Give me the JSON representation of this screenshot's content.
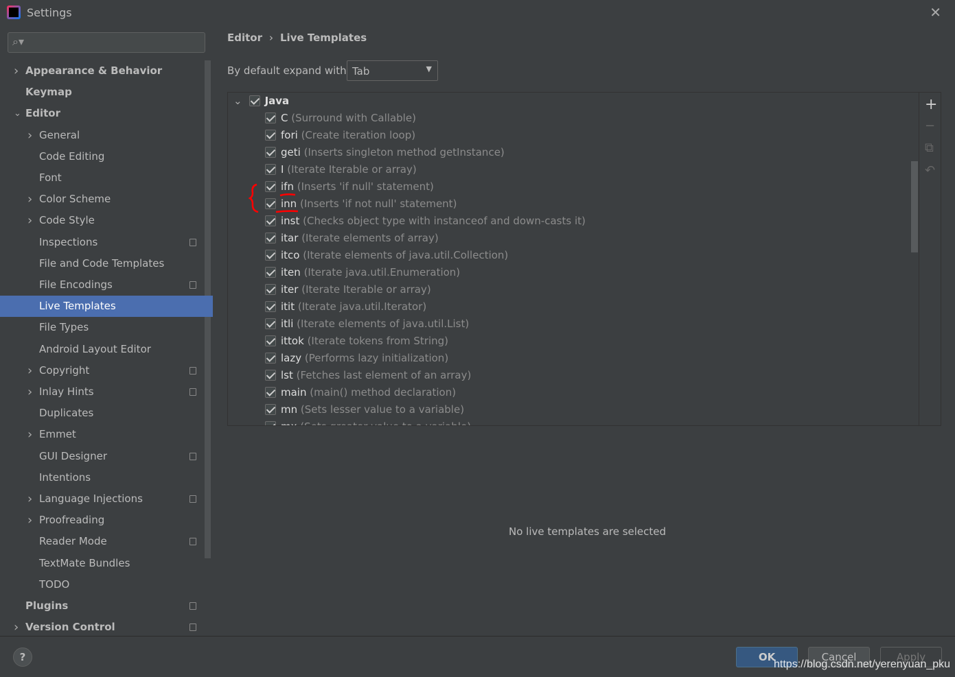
{
  "window": {
    "title": "Settings"
  },
  "search": {
    "placeholder": ""
  },
  "sidebar": {
    "items": [
      {
        "label": "Appearance & Behavior",
        "level": 0,
        "arrow": "right",
        "bold": true
      },
      {
        "label": "Keymap",
        "level": 0,
        "bold": true
      },
      {
        "label": "Editor",
        "level": 0,
        "arrow": "down",
        "bold": true
      },
      {
        "label": "General",
        "level": 1,
        "arrow": "right"
      },
      {
        "label": "Code Editing",
        "level": 1
      },
      {
        "label": "Font",
        "level": 1
      },
      {
        "label": "Color Scheme",
        "level": 1,
        "arrow": "right"
      },
      {
        "label": "Code Style",
        "level": 1,
        "arrow": "right"
      },
      {
        "label": "Inspections",
        "level": 1,
        "project": true
      },
      {
        "label": "File and Code Templates",
        "level": 1
      },
      {
        "label": "File Encodings",
        "level": 1,
        "project": true
      },
      {
        "label": "Live Templates",
        "level": 1,
        "selected": true
      },
      {
        "label": "File Types",
        "level": 1
      },
      {
        "label": "Android Layout Editor",
        "level": 1
      },
      {
        "label": "Copyright",
        "level": 1,
        "arrow": "right",
        "project": true
      },
      {
        "label": "Inlay Hints",
        "level": 1,
        "arrow": "right",
        "project": true
      },
      {
        "label": "Duplicates",
        "level": 1
      },
      {
        "label": "Emmet",
        "level": 1,
        "arrow": "right"
      },
      {
        "label": "GUI Designer",
        "level": 1,
        "project": true
      },
      {
        "label": "Intentions",
        "level": 1
      },
      {
        "label": "Language Injections",
        "level": 1,
        "arrow": "right",
        "project": true
      },
      {
        "label": "Proofreading",
        "level": 1,
        "arrow": "right"
      },
      {
        "label": "Reader Mode",
        "level": 1,
        "project": true
      },
      {
        "label": "TextMate Bundles",
        "level": 1
      },
      {
        "label": "TODO",
        "level": 1
      },
      {
        "label": "Plugins",
        "level": 0,
        "bold": true,
        "project": true
      },
      {
        "label": "Version Control",
        "level": 0,
        "arrow": "right",
        "bold": true,
        "project": true
      }
    ]
  },
  "breadcrumb": {
    "parent": "Editor",
    "separator": "›",
    "current": "Live Templates"
  },
  "expand": {
    "label": "By default expand with",
    "value": "Tab"
  },
  "templates": {
    "group": {
      "name": "Java",
      "checked": true,
      "expanded": true
    },
    "items": [
      {
        "abbr": "C",
        "desc": "(Surround with Callable)",
        "checked": true
      },
      {
        "abbr": "fori",
        "desc": "(Create iteration loop)",
        "checked": true
      },
      {
        "abbr": "geti",
        "desc": "(Inserts singleton method getInstance)",
        "checked": true
      },
      {
        "abbr": "I",
        "desc": "(Iterate Iterable or array)",
        "checked": true
      },
      {
        "abbr": "ifn",
        "desc": "(Inserts 'if null' statement)",
        "checked": true
      },
      {
        "abbr": "inn",
        "desc": "(Inserts 'if not null' statement)",
        "checked": true
      },
      {
        "abbr": "inst",
        "desc": "(Checks object type with instanceof and down-casts it)",
        "checked": true
      },
      {
        "abbr": "itar",
        "desc": "(Iterate elements of array)",
        "checked": true
      },
      {
        "abbr": "itco",
        "desc": "(Iterate elements of java.util.Collection)",
        "checked": true
      },
      {
        "abbr": "iten",
        "desc": "(Iterate java.util.Enumeration)",
        "checked": true
      },
      {
        "abbr": "iter",
        "desc": "(Iterate Iterable or array)",
        "checked": true
      },
      {
        "abbr": "itit",
        "desc": "(Iterate java.util.Iterator)",
        "checked": true
      },
      {
        "abbr": "itli",
        "desc": "(Iterate elements of java.util.List)",
        "checked": true
      },
      {
        "abbr": "ittok",
        "desc": "(Iterate tokens from String)",
        "checked": true
      },
      {
        "abbr": "lazy",
        "desc": "(Performs lazy initialization)",
        "checked": true
      },
      {
        "abbr": "lst",
        "desc": "(Fetches last element of an array)",
        "checked": true
      },
      {
        "abbr": "main",
        "desc": "(main() method declaration)",
        "checked": true
      },
      {
        "abbr": "mn",
        "desc": "(Sets lesser value to a variable)",
        "checked": true
      },
      {
        "abbr": "mx",
        "desc": "(Sets greater value to a variable)",
        "checked": true
      }
    ]
  },
  "toolbar": {
    "add": "+",
    "remove": "−",
    "copy": "copy-icon",
    "restore": "undo-icon"
  },
  "empty_message": "No live templates are selected",
  "footer": {
    "help": "?",
    "ok": "OK",
    "cancel": "Cancel",
    "apply": "Apply"
  },
  "watermark": "https://blog.csdn.net/yerenyuan_pku",
  "colors": {
    "selection": "#4b6eaf",
    "ok_button": "#365880",
    "annotation": "#ff0000"
  }
}
